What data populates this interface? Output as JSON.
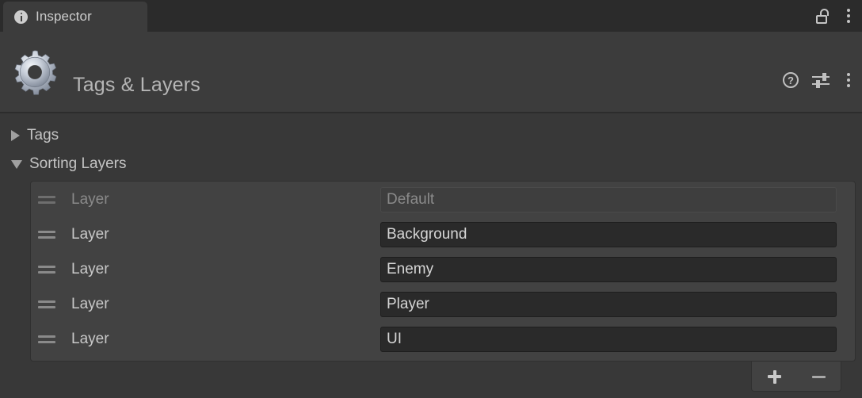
{
  "window": {
    "tab": {
      "label": "Inspector",
      "icon": "info-icon"
    },
    "controls": {
      "lock": "lock-open-icon",
      "menu": "kebab-menu-icon"
    }
  },
  "component": {
    "title": "Tags & Layers",
    "icon": "gear-icon",
    "actions": {
      "help": "?",
      "preset": "sliders-icon",
      "menu": "kebab-menu-icon"
    }
  },
  "sections": [
    {
      "label": "Tags",
      "expanded": false
    },
    {
      "label": "Sorting Layers",
      "expanded": true
    }
  ],
  "sorting_layers": {
    "row_label": "Layer",
    "rows": [
      {
        "label": "Layer",
        "value": "Default",
        "disabled": true
      },
      {
        "label": "Layer",
        "value": "Background",
        "disabled": false
      },
      {
        "label": "Layer",
        "value": "Enemy",
        "disabled": false
      },
      {
        "label": "Layer",
        "value": "Player",
        "disabled": false
      },
      {
        "label": "Layer",
        "value": "UI",
        "disabled": false
      }
    ],
    "footer": {
      "add": "+",
      "remove": "–"
    }
  },
  "colors": {
    "window_bg": "#383838",
    "tabbar_bg": "#2b2b2b",
    "tab_bg": "#3c3c3c",
    "panel_bg": "#424242",
    "field_bg": "#2a2a2a",
    "text": "#c9c9c9",
    "text_disabled": "#8a8a8a"
  }
}
